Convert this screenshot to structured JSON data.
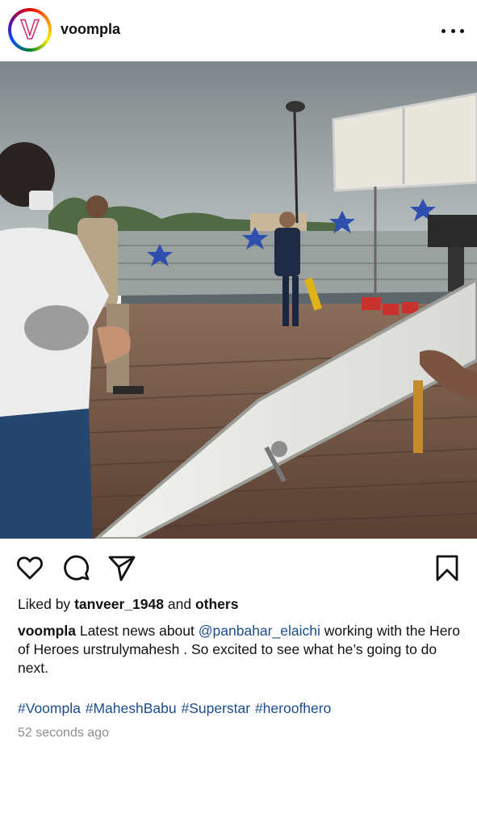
{
  "post": {
    "username": "voompla",
    "avatar_letter": "V",
    "photo_alt": "",
    "likes": {
      "prefix": "Liked by",
      "user": "tanveer_1948",
      "middle": "and",
      "suffix": "others"
    },
    "caption": {
      "user": "voompla",
      "text_before": "Latest news about",
      "mention": "@panbahar_elaichi",
      "text_after": "working with the Hero of Heroes urstrulymahesh . So excited to see what he’s going to do next."
    },
    "hashtags": [
      "#Voompla",
      "#MaheshBabu",
      "#Superstar",
      "#heroofhero"
    ],
    "timestamp": "52 seconds ago"
  },
  "icons": {
    "like": "heart-icon",
    "comment": "comment-bubble-icon",
    "share": "paper-plane-icon",
    "save": "bookmark-icon",
    "more": "more-dots-icon"
  },
  "colors": {
    "text": "#111111",
    "link": "#1a4d8f",
    "muted": "#8e8e8e"
  }
}
